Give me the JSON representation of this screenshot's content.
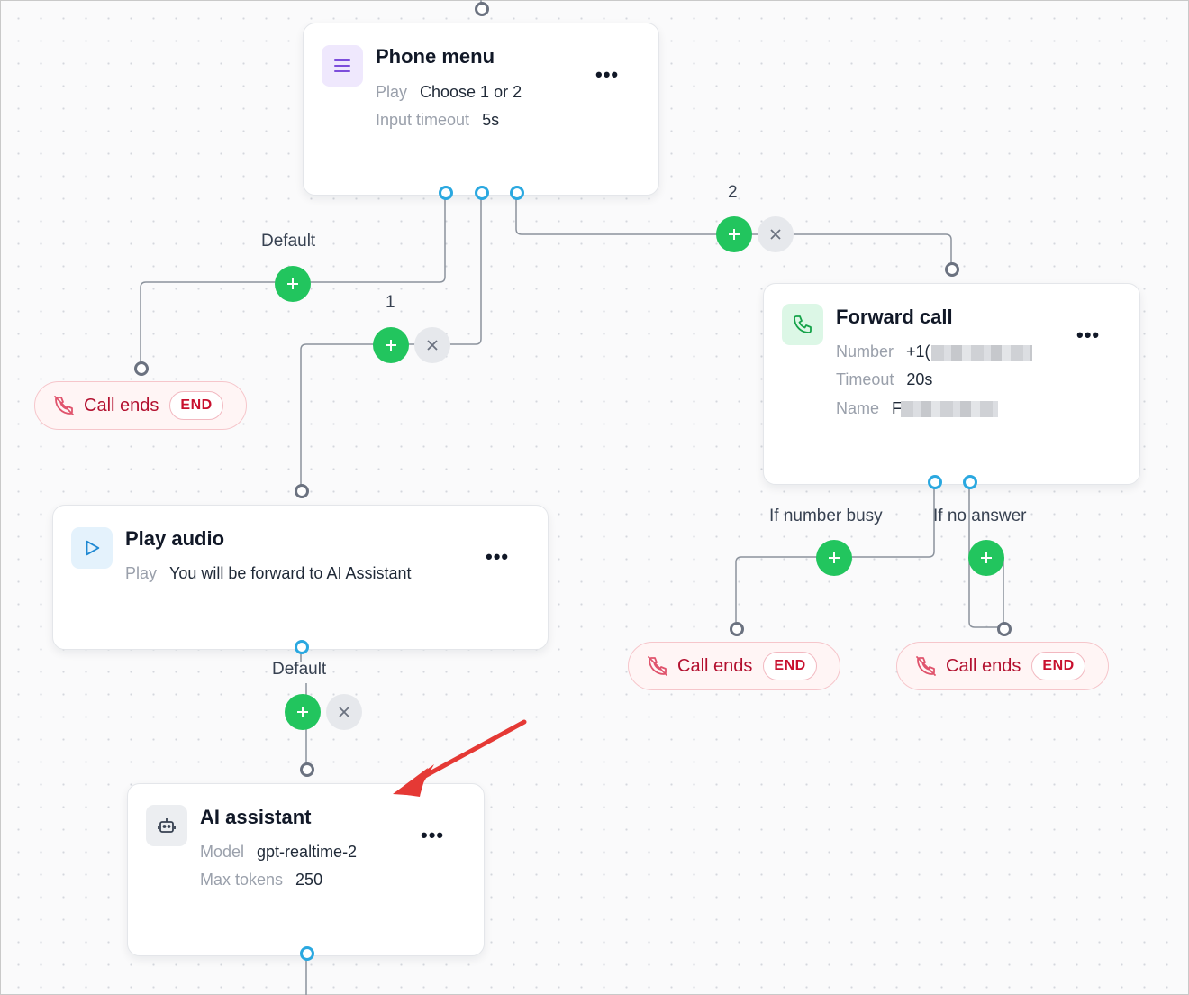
{
  "nodes": {
    "phone_menu": {
      "title": "Phone menu",
      "props": [
        {
          "key": "Play",
          "value": "Choose 1 or 2"
        },
        {
          "key": "Input timeout",
          "value": "5s"
        }
      ],
      "more": "•••",
      "icon": "menu-lines-icon"
    },
    "forward_call": {
      "title": "Forward call",
      "props": [
        {
          "key": "Number",
          "value": "+1("
        },
        {
          "key": "Timeout",
          "value": "20s"
        },
        {
          "key": "Name",
          "value": "F"
        }
      ],
      "more": "•••",
      "icon": "phone-icon"
    },
    "play_audio": {
      "title": "Play audio",
      "props": [
        {
          "key": "Play",
          "value": "You will be forward to AI Assistant"
        }
      ],
      "more": "•••",
      "icon": "play-icon"
    },
    "ai_assistant": {
      "title": "AI assistant",
      "props": [
        {
          "key": "Model",
          "value": "gpt-realtime-2"
        },
        {
          "key": "Max tokens",
          "value": "250"
        }
      ],
      "more": "•••",
      "icon": "robot-icon"
    }
  },
  "edge_labels": {
    "menu_default": "Default",
    "menu_option_1": "1",
    "menu_option_2": "2",
    "forward_busy": "If number busy",
    "forward_no_answer": "If no answer",
    "audio_default": "Default"
  },
  "end_nodes": {
    "label": "Call ends",
    "tag": "END"
  },
  "colors": {
    "add_button": "#22c55e",
    "end_text": "#b3102f",
    "output_port": "#2aa8e0",
    "annotation_arrow": "#e53935"
  }
}
